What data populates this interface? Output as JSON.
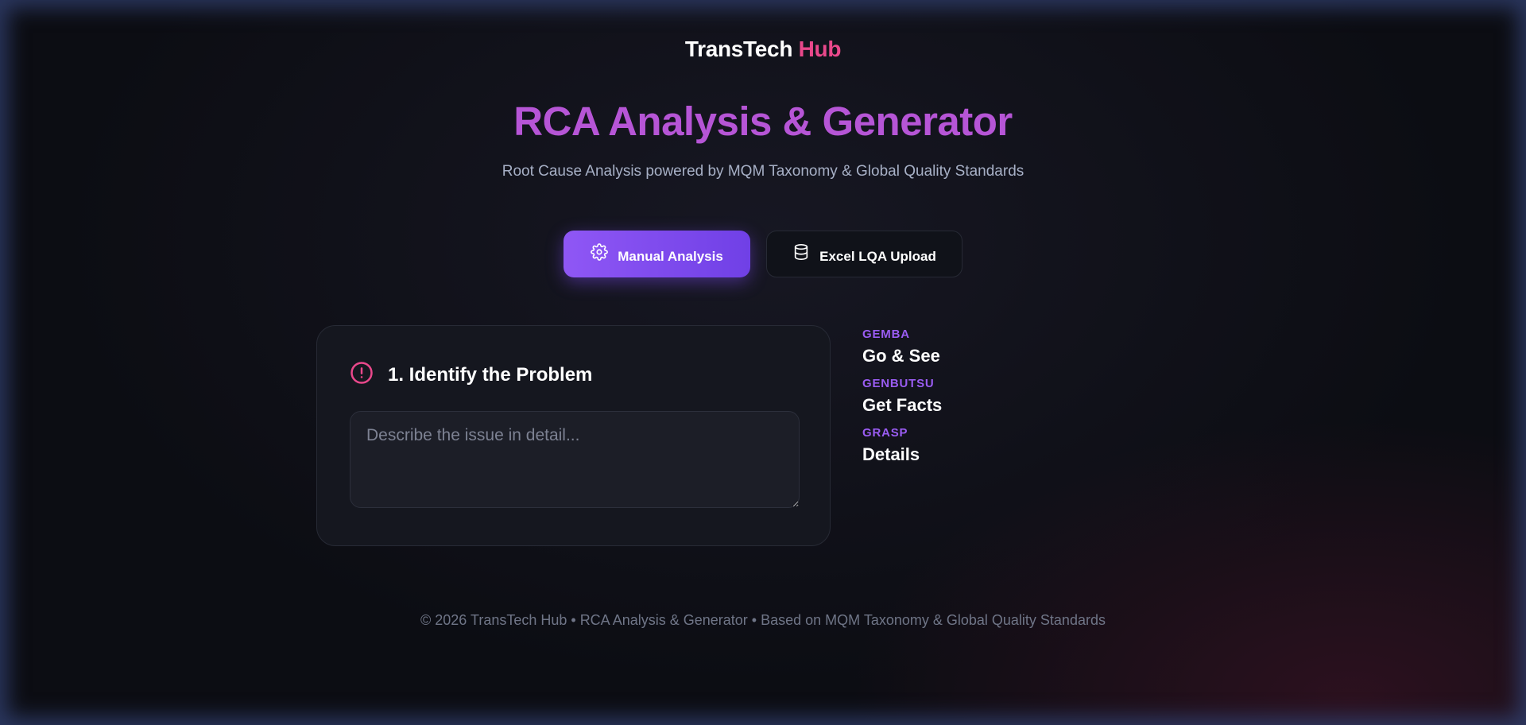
{
  "brand": {
    "name": "TransTech",
    "accent": "Hub"
  },
  "hero": {
    "title": "RCA Analysis & Generator",
    "subtitle": "Root Cause Analysis powered by MQM Taxonomy & Global Quality Standards"
  },
  "tabs": [
    {
      "label": "Manual Analysis",
      "icon": "gear-icon",
      "active": true
    },
    {
      "label": "Excel LQA Upload",
      "icon": "database-icon",
      "active": false
    }
  ],
  "problem_card": {
    "icon": "alert-circle-icon",
    "title": "1. Identify the Problem",
    "placeholder": "Describe the issue in detail...",
    "value": ""
  },
  "principles": [
    {
      "tag": "GEMBA",
      "text": "Go & See"
    },
    {
      "tag": "GENBUTSU",
      "text": "Get Facts"
    },
    {
      "tag": "GRASP",
      "text": "Details"
    }
  ],
  "footer": "© 2026 TransTech Hub • RCA Analysis & Generator • Based on MQM Taxonomy & Global Quality Standards",
  "colors": {
    "brand_accent": "#e9488b",
    "title": "#b655d6",
    "primary": "#7c4af0",
    "tag": "#9a5cf2",
    "alert_icon": "#e9488b"
  }
}
